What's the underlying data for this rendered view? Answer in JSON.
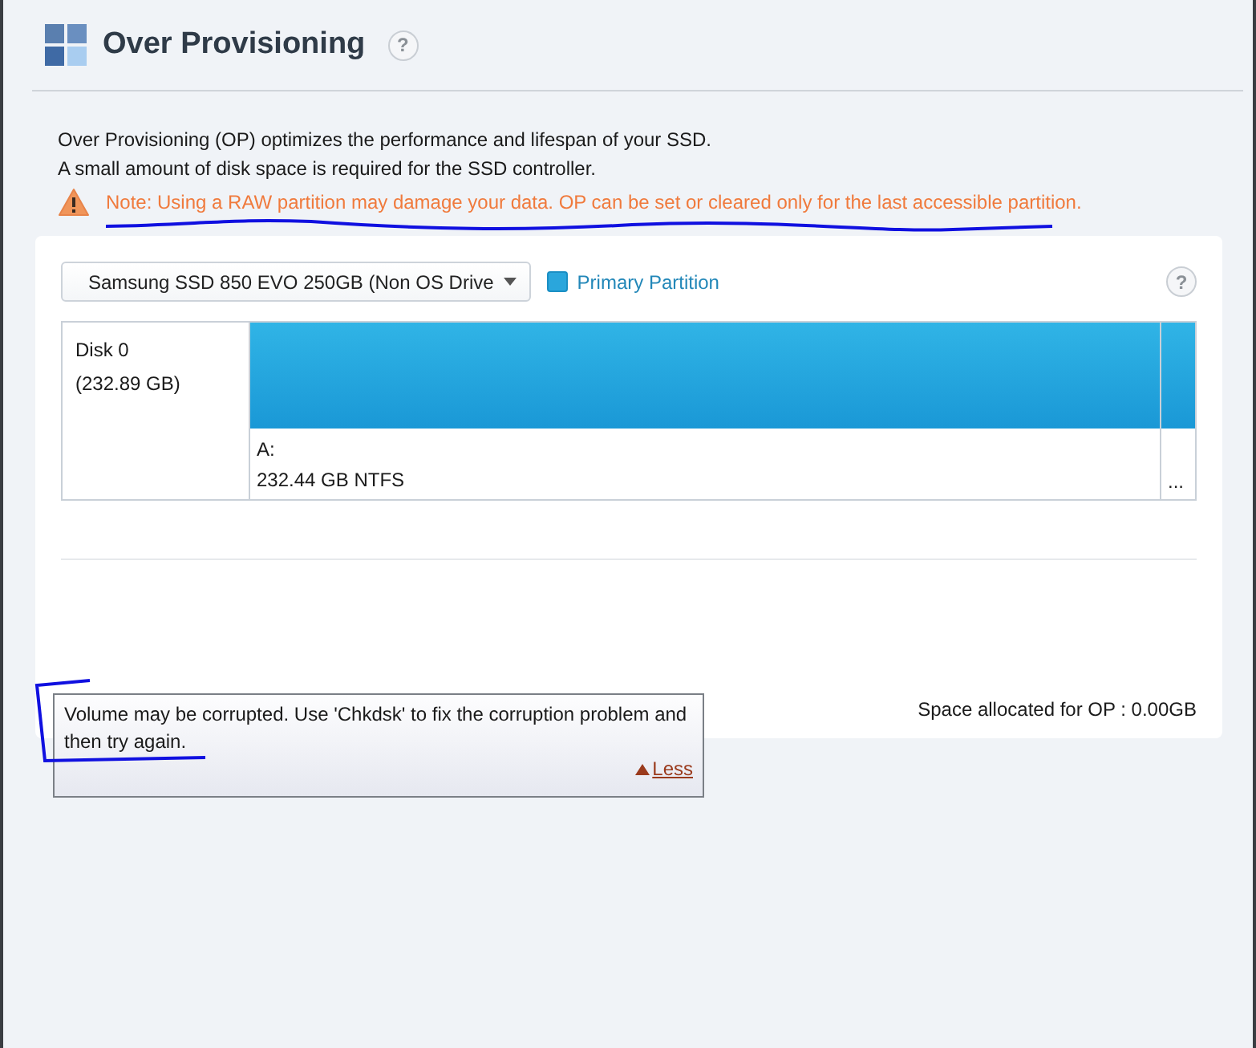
{
  "header": {
    "title": "Over Provisioning",
    "help": "?"
  },
  "description": [
    "Over Provisioning (OP) optimizes the performance and lifespan of your SSD.",
    "A small amount of disk space is required for the SSD controller."
  ],
  "warning": {
    "text": "Note: Using a RAW partition may damage your data. OP can be set or cleared only for the last accessible partition."
  },
  "drive_select": {
    "value": "Samsung SSD 850 EVO 250GB (Non OS Drive"
  },
  "legend": {
    "label": "Primary Partition"
  },
  "card_help": "?",
  "disk": {
    "name": "Disk 0",
    "size": "(232.89 GB)",
    "partitions": [
      {
        "label": "A:",
        "detail": "232.44 GB NTFS"
      }
    ],
    "more": "..."
  },
  "space_allocated": "Space allocated for OP : 0.00GB",
  "tooltip": {
    "text": "Volume may be corrupted. Use 'Chkdsk' to fix the corruption problem and then try again.",
    "toggle": "Less",
    "expanded": true
  }
}
